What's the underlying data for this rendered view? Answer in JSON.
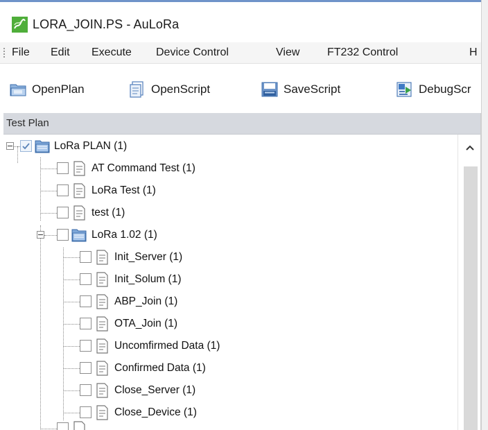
{
  "window": {
    "title": "LORA_JOIN.PS - AuLoRa",
    "accent": "#6f93c9"
  },
  "menu": [
    "File",
    "Edit",
    "Execute",
    "Device Control",
    "View",
    "FT232 Control",
    "H"
  ],
  "toolbar": [
    {
      "label": "OpenPlan",
      "icon": "folder-open-icon"
    },
    {
      "label": "OpenScript",
      "icon": "document-icon"
    },
    {
      "label": "SaveScript",
      "icon": "save-icon"
    },
    {
      "label": "DebugScr",
      "icon": "debug-icon"
    }
  ],
  "panel": {
    "title": "Test Plan"
  },
  "tree": [
    {
      "label": "LoRa PLAN (1)",
      "type": "folder",
      "level": 0,
      "checked": true,
      "expanded": true
    },
    {
      "label": "AT Command Test (1)",
      "type": "script",
      "level": 1,
      "checked": false
    },
    {
      "label": "LoRa Test (1)",
      "type": "script",
      "level": 1,
      "checked": false
    },
    {
      "label": "test (1)",
      "type": "script",
      "level": 1,
      "checked": false
    },
    {
      "label": "LoRa 1.02 (1)",
      "type": "folder",
      "level": 1,
      "checked": false,
      "expanded": true
    },
    {
      "label": "Init_Server (1)",
      "type": "script",
      "level": 2,
      "checked": false
    },
    {
      "label": "Init_Solum (1)",
      "type": "script",
      "level": 2,
      "checked": false
    },
    {
      "label": "ABP_Join (1)",
      "type": "script",
      "level": 2,
      "checked": false
    },
    {
      "label": "OTA_Join (1)",
      "type": "script",
      "level": 2,
      "checked": false
    },
    {
      "label": "Uncomfirmed Data (1)",
      "type": "script",
      "level": 2,
      "checked": false
    },
    {
      "label": "Confirmed Data (1)",
      "type": "script",
      "level": 2,
      "checked": false
    },
    {
      "label": "Close_Server (1)",
      "type": "script",
      "level": 2,
      "checked": false
    },
    {
      "label": "Close_Device (1)",
      "type": "script",
      "level": 2,
      "checked": false
    }
  ]
}
